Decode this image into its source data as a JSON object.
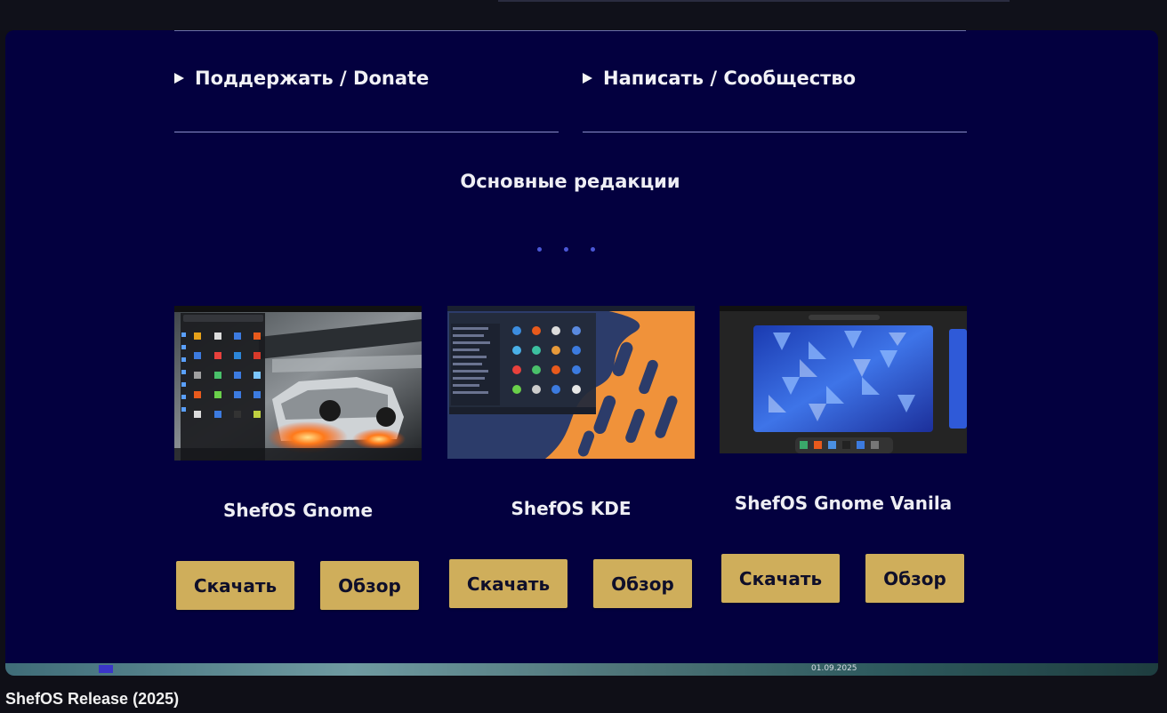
{
  "sections": {
    "donate_label": "Поддержать / Donate",
    "community_label": "Написать / Сообщество"
  },
  "heading": "Основные редакции",
  "editions": [
    {
      "title": "ShefOS Gnome",
      "download_label": "Скачать",
      "review_label": "Обзор"
    },
    {
      "title": "ShefOS KDE",
      "download_label": "Скачать",
      "review_label": "Обзор"
    },
    {
      "title": "ShefOS Gnome Vanila",
      "download_label": "Скачать",
      "review_label": "Обзор"
    }
  ],
  "video_title": "ShefOS Release (2025)",
  "taskbar_date": "01.09.2025",
  "colors": {
    "page_background": "#03003f",
    "button_background": "#cfae5b",
    "dot_color": "#4b57d6"
  }
}
